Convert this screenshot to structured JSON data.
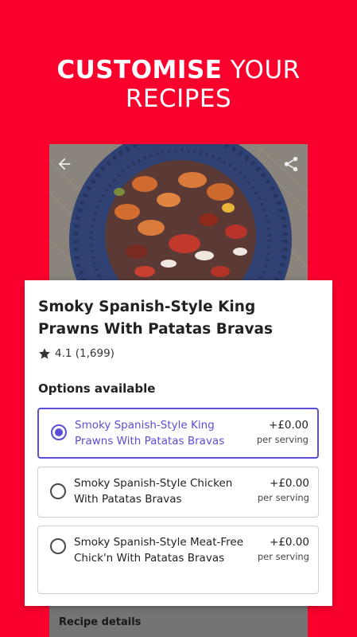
{
  "headline": {
    "bold": "CUSTOMISE",
    "light": "YOUR",
    "line2": "RECIPES"
  },
  "recipe": {
    "title": "Smoky Spanish-Style King Prawns With Patatas Bravas",
    "rating": "4.1 (1,699)"
  },
  "options": {
    "heading": "Options available",
    "items": [
      {
        "name": "Smoky Spanish-Style King Prawns With Patatas Bravas",
        "price": "+£0.00",
        "unit": "per serving",
        "selected": true
      },
      {
        "name": "Smoky Spanish-Style Chicken With Patatas Bravas",
        "price": "+£0.00",
        "unit": "per serving",
        "selected": false
      },
      {
        "name": "Smoky Spanish-Style Meat-Free Chick'n With Patatas Bravas",
        "price": "+£0.00",
        "unit": "per serving",
        "selected": false
      }
    ]
  },
  "details_bar": {
    "label": "Recipe details"
  },
  "icons": {
    "back": "arrow-left-icon",
    "share": "share-icon",
    "rating": "star-icon"
  },
  "colors": {
    "brand": "#f9002d",
    "accent": "#5a4fd6"
  }
}
